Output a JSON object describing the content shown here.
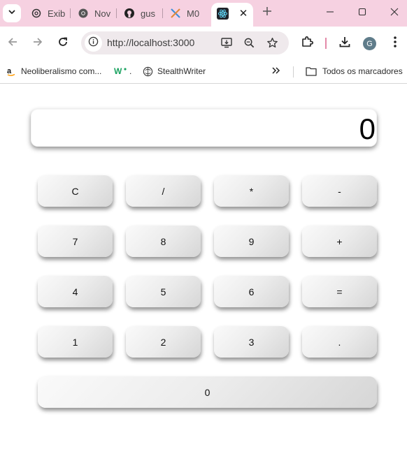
{
  "browser": {
    "tabs": [
      {
        "label": "Exib",
        "icon": "openai-icon"
      },
      {
        "label": "Nov",
        "icon": "chrome-icon"
      },
      {
        "label": "gus",
        "icon": "github-icon"
      },
      {
        "label": "M0",
        "icon": "x-logo-icon"
      }
    ],
    "active_tab": {
      "icon": "react-icon"
    },
    "url": "http://localhost:3000",
    "profile_initial": "G",
    "bookmarks": [
      {
        "label": "Neoliberalismo com...",
        "icon": "amazon-icon"
      },
      {
        "label": ".",
        "icon": "w-logo-icon"
      },
      {
        "label": "StealthWriter",
        "icon": "stealthwriter-icon"
      }
    ],
    "all_bookmarks_label": "Todos os marcadores"
  },
  "calculator": {
    "display": "0",
    "keys": [
      [
        "C",
        "/",
        "*",
        "-"
      ],
      [
        "7",
        "8",
        "9",
        "+"
      ],
      [
        "4",
        "5",
        "6",
        "="
      ],
      [
        "1",
        "2",
        "3",
        "."
      ],
      [
        "0"
      ]
    ]
  }
}
